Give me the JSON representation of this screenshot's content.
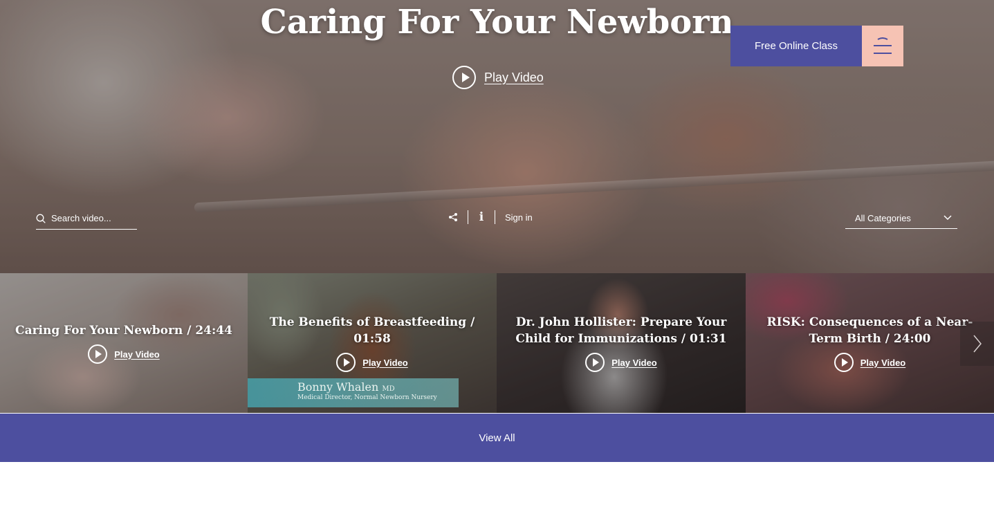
{
  "hero": {
    "title": "Caring For Your Newborn",
    "play_label": "Play Video"
  },
  "header": {
    "class_button": "Free Online Class",
    "menu_icon": "hamburger-wave-icon"
  },
  "toolbar": {
    "search_placeholder": "Search video...",
    "share_icon": "share-icon",
    "info_label": "i",
    "signin_label": "Sign in",
    "category_selected": "All Categories"
  },
  "videos": [
    {
      "title": "Caring For Your Newborn / 24:44",
      "play_label": "Play Video"
    },
    {
      "title": "The Benefits of Breastfeeding / 01:58",
      "play_label": "Play Video",
      "overlay_name": "Bonny Whalen",
      "overlay_suffix": "MD",
      "overlay_role": "Medical Director, Normal Newborn Nursery"
    },
    {
      "title": "Dr. John Hollister: Prepare Your Child for Immunizations / 01:31",
      "play_label": "Play Video"
    },
    {
      "title": "RISK: Consequences of a Near-Term Birth / 24:00",
      "play_label": "Play Video"
    }
  ],
  "view_all": "View All",
  "colors": {
    "brand_purple": "#4d4f9f",
    "accent_peach": "#f6c3b4"
  }
}
